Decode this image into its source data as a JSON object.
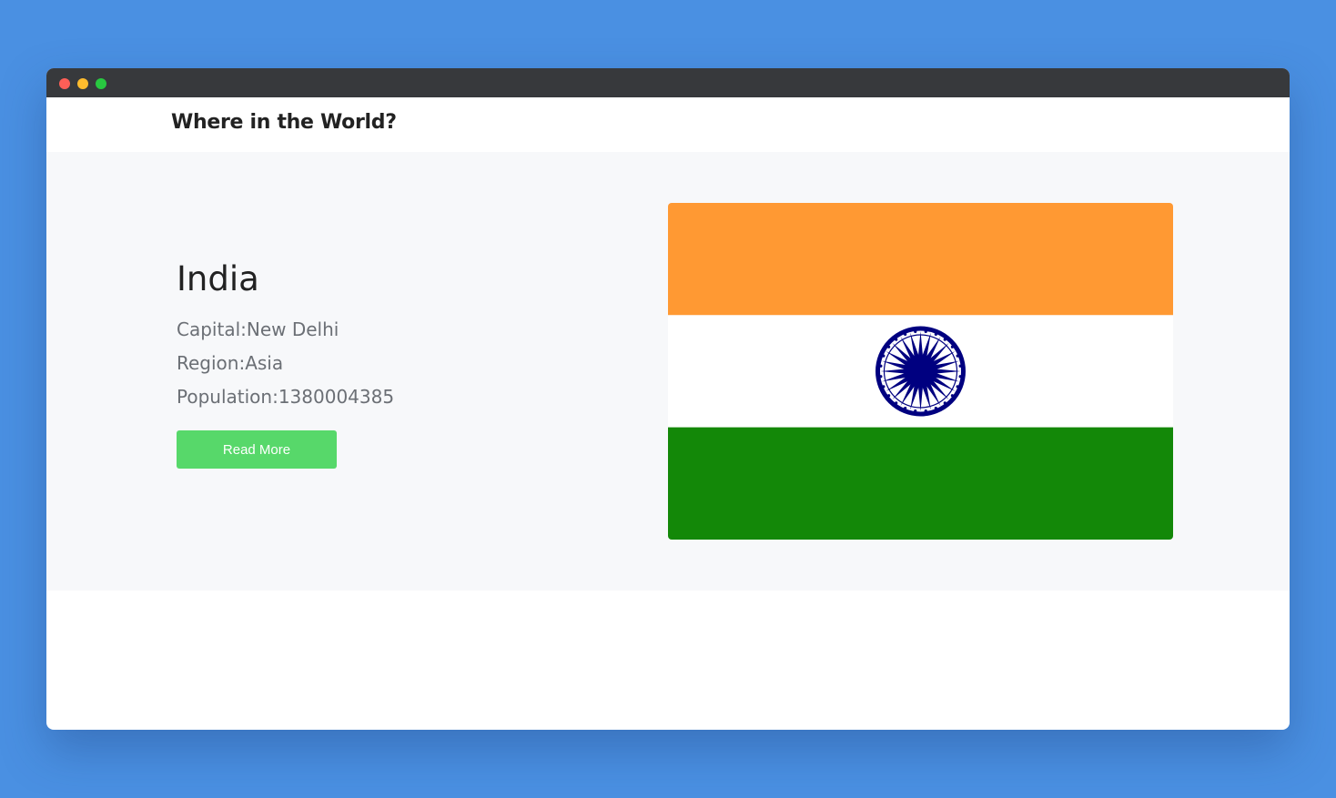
{
  "window": {
    "controls": [
      "close",
      "minimize",
      "maximize"
    ]
  },
  "navbar": {
    "brand": "Where in the World?"
  },
  "country": {
    "name": "India",
    "capital_text": "Capital:New Delhi",
    "region_text": "Region:Asia",
    "population_text": "Population:1380004385",
    "read_more_label": "Read More"
  },
  "flag": {
    "colors": {
      "saffron": "#ff9933",
      "white": "#ffffff",
      "green": "#138808",
      "chakra": "#000080"
    }
  },
  "colors": {
    "background": "#4a90e2",
    "button": "#57d86a",
    "hero": "#f7f8fa"
  }
}
